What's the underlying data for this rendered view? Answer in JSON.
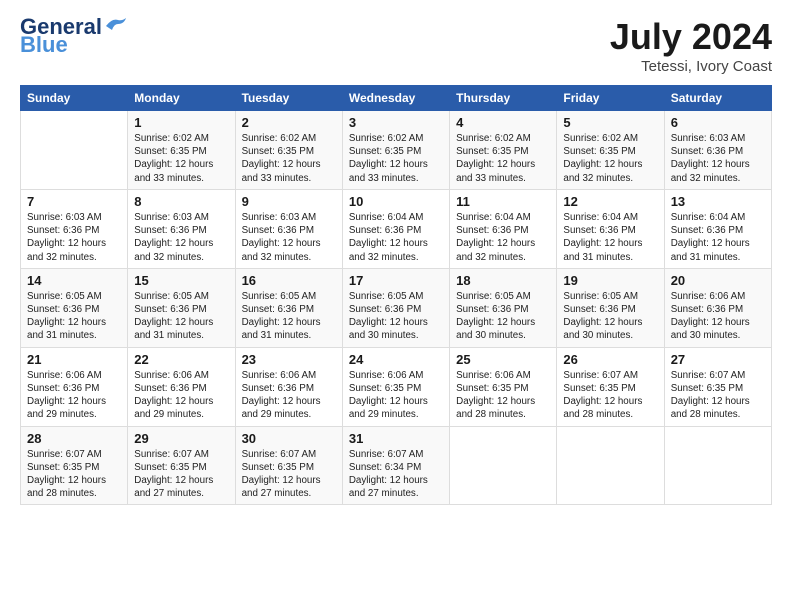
{
  "header": {
    "logo_line1": "General",
    "logo_line2": "Blue",
    "month_year": "July 2024",
    "location": "Tetessi, Ivory Coast"
  },
  "days_of_week": [
    "Sunday",
    "Monday",
    "Tuesday",
    "Wednesday",
    "Thursday",
    "Friday",
    "Saturday"
  ],
  "weeks": [
    [
      {
        "day": "",
        "text": ""
      },
      {
        "day": "1",
        "text": "Sunrise: 6:02 AM\nSunset: 6:35 PM\nDaylight: 12 hours\nand 33 minutes."
      },
      {
        "day": "2",
        "text": "Sunrise: 6:02 AM\nSunset: 6:35 PM\nDaylight: 12 hours\nand 33 minutes."
      },
      {
        "day": "3",
        "text": "Sunrise: 6:02 AM\nSunset: 6:35 PM\nDaylight: 12 hours\nand 33 minutes."
      },
      {
        "day": "4",
        "text": "Sunrise: 6:02 AM\nSunset: 6:35 PM\nDaylight: 12 hours\nand 33 minutes."
      },
      {
        "day": "5",
        "text": "Sunrise: 6:02 AM\nSunset: 6:35 PM\nDaylight: 12 hours\nand 32 minutes."
      },
      {
        "day": "6",
        "text": "Sunrise: 6:03 AM\nSunset: 6:36 PM\nDaylight: 12 hours\nand 32 minutes."
      }
    ],
    [
      {
        "day": "7",
        "text": "Sunrise: 6:03 AM\nSunset: 6:36 PM\nDaylight: 12 hours\nand 32 minutes."
      },
      {
        "day": "8",
        "text": "Sunrise: 6:03 AM\nSunset: 6:36 PM\nDaylight: 12 hours\nand 32 minutes."
      },
      {
        "day": "9",
        "text": "Sunrise: 6:03 AM\nSunset: 6:36 PM\nDaylight: 12 hours\nand 32 minutes."
      },
      {
        "day": "10",
        "text": "Sunrise: 6:04 AM\nSunset: 6:36 PM\nDaylight: 12 hours\nand 32 minutes."
      },
      {
        "day": "11",
        "text": "Sunrise: 6:04 AM\nSunset: 6:36 PM\nDaylight: 12 hours\nand 32 minutes."
      },
      {
        "day": "12",
        "text": "Sunrise: 6:04 AM\nSunset: 6:36 PM\nDaylight: 12 hours\nand 31 minutes."
      },
      {
        "day": "13",
        "text": "Sunrise: 6:04 AM\nSunset: 6:36 PM\nDaylight: 12 hours\nand 31 minutes."
      }
    ],
    [
      {
        "day": "14",
        "text": "Sunrise: 6:05 AM\nSunset: 6:36 PM\nDaylight: 12 hours\nand 31 minutes."
      },
      {
        "day": "15",
        "text": "Sunrise: 6:05 AM\nSunset: 6:36 PM\nDaylight: 12 hours\nand 31 minutes."
      },
      {
        "day": "16",
        "text": "Sunrise: 6:05 AM\nSunset: 6:36 PM\nDaylight: 12 hours\nand 31 minutes."
      },
      {
        "day": "17",
        "text": "Sunrise: 6:05 AM\nSunset: 6:36 PM\nDaylight: 12 hours\nand 30 minutes."
      },
      {
        "day": "18",
        "text": "Sunrise: 6:05 AM\nSunset: 6:36 PM\nDaylight: 12 hours\nand 30 minutes."
      },
      {
        "day": "19",
        "text": "Sunrise: 6:05 AM\nSunset: 6:36 PM\nDaylight: 12 hours\nand 30 minutes."
      },
      {
        "day": "20",
        "text": "Sunrise: 6:06 AM\nSunset: 6:36 PM\nDaylight: 12 hours\nand 30 minutes."
      }
    ],
    [
      {
        "day": "21",
        "text": "Sunrise: 6:06 AM\nSunset: 6:36 PM\nDaylight: 12 hours\nand 29 minutes."
      },
      {
        "day": "22",
        "text": "Sunrise: 6:06 AM\nSunset: 6:36 PM\nDaylight: 12 hours\nand 29 minutes."
      },
      {
        "day": "23",
        "text": "Sunrise: 6:06 AM\nSunset: 6:36 PM\nDaylight: 12 hours\nand 29 minutes."
      },
      {
        "day": "24",
        "text": "Sunrise: 6:06 AM\nSunset: 6:35 PM\nDaylight: 12 hours\nand 29 minutes."
      },
      {
        "day": "25",
        "text": "Sunrise: 6:06 AM\nSunset: 6:35 PM\nDaylight: 12 hours\nand 28 minutes."
      },
      {
        "day": "26",
        "text": "Sunrise: 6:07 AM\nSunset: 6:35 PM\nDaylight: 12 hours\nand 28 minutes."
      },
      {
        "day": "27",
        "text": "Sunrise: 6:07 AM\nSunset: 6:35 PM\nDaylight: 12 hours\nand 28 minutes."
      }
    ],
    [
      {
        "day": "28",
        "text": "Sunrise: 6:07 AM\nSunset: 6:35 PM\nDaylight: 12 hours\nand 28 minutes."
      },
      {
        "day": "29",
        "text": "Sunrise: 6:07 AM\nSunset: 6:35 PM\nDaylight: 12 hours\nand 27 minutes."
      },
      {
        "day": "30",
        "text": "Sunrise: 6:07 AM\nSunset: 6:35 PM\nDaylight: 12 hours\nand 27 minutes."
      },
      {
        "day": "31",
        "text": "Sunrise: 6:07 AM\nSunset: 6:34 PM\nDaylight: 12 hours\nand 27 minutes."
      },
      {
        "day": "",
        "text": ""
      },
      {
        "day": "",
        "text": ""
      },
      {
        "day": "",
        "text": ""
      }
    ]
  ]
}
